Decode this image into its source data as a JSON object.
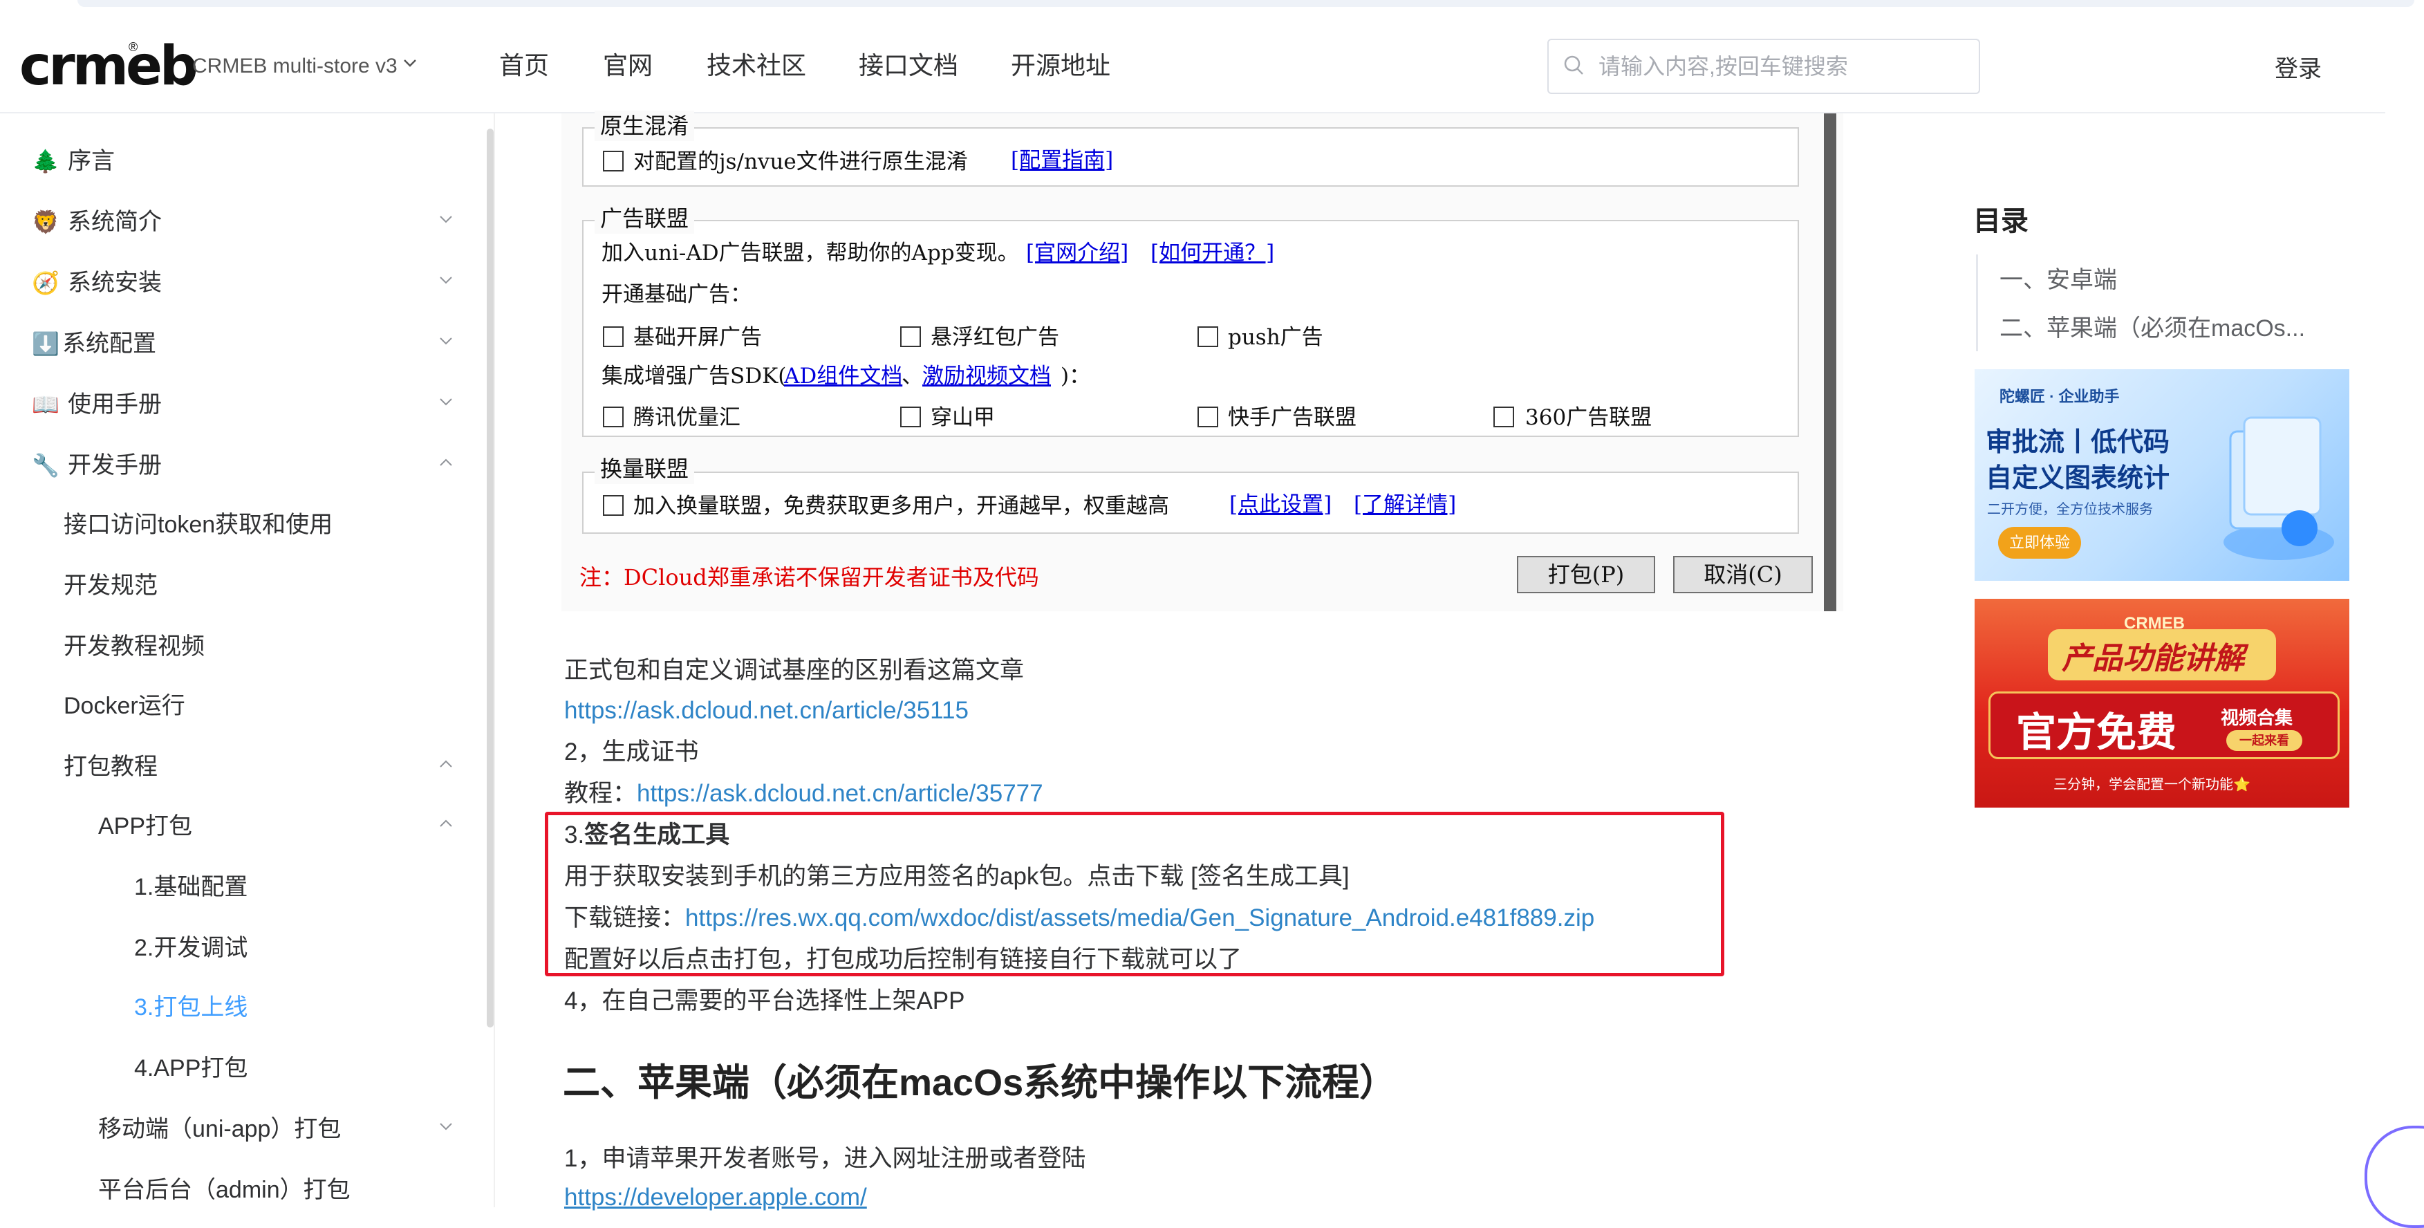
{
  "header": {
    "logo_text": "crmeb",
    "logo_reg": "®",
    "version": "CRMEB multi-store v3",
    "nav": [
      "首页",
      "官网",
      "技术社区",
      "接口文档",
      "开源地址"
    ],
    "search_placeholder": "请输入内容,按回车键搜索",
    "login": "登录"
  },
  "sidebar": {
    "items": [
      {
        "emoji": "🌲",
        "label": "序言"
      },
      {
        "emoji": "🦁",
        "label": "系统简介"
      },
      {
        "emoji": "🧭",
        "label": "系统安装"
      },
      {
        "emoji": "⬇️",
        "label": "系统配置"
      },
      {
        "emoji": "📖",
        "label": "使用手册"
      },
      {
        "emoji": "🔧",
        "label": "开发手册"
      },
      {
        "label": "接口访问token获取和使用"
      },
      {
        "label": "开发规范"
      },
      {
        "label": "开发教程视频"
      },
      {
        "label": "Docker运行"
      },
      {
        "label": "打包教程"
      },
      {
        "label": "APP打包"
      },
      {
        "label": "1.基础配置"
      },
      {
        "label": "2.开发调试"
      },
      {
        "label": "3.打包上线"
      },
      {
        "label": "4.APP打包"
      },
      {
        "label": "移动端（uni-app）打包"
      },
      {
        "label": "平台后台（admin）打包"
      }
    ]
  },
  "dialog": {
    "native": {
      "title": "原生混淆",
      "option": "对配置的js/nvue文件进行原生混淆",
      "link": "[配置指南]"
    },
    "ad": {
      "title": "广告联盟",
      "intro": "加入uni-AD广告联盟，帮助你的App变现。",
      "link1": "[官网介绍]",
      "link2": "[如何开通？]",
      "basic_title": "开通基础广告：",
      "basic": [
        "基础开屏广告",
        "悬浮红包广告",
        "push广告"
      ],
      "sdk_prefix": "集成增强广告SDK(",
      "sdk_link1": "AD组件文档",
      "sdk_sep": "、",
      "sdk_link2": "激励视频文档",
      "sdk_suffix": ")：",
      "sdk": [
        "腾讯优量汇",
        "穿山甲",
        "快手广告联盟",
        "360广告联盟"
      ]
    },
    "exchange": {
      "title": "换量联盟",
      "option": "加入换量联盟，免费获取更多用户，开通越早，权重越高",
      "link1": "[点此设置]",
      "link2": "[了解详情]"
    },
    "note": "注：DCloud郑重承诺不保留开发者证书及代码",
    "btn_pack": "打包(P)",
    "btn_cancel": "取消(C)"
  },
  "article": {
    "p1": "正式包和自定义调试基座的区别看这篇文章",
    "link1": "https://ask.dcloud.net.cn/article/35115",
    "p2": "2，生成证书",
    "p3_prefix": "教程：",
    "link2": "https://ask.dcloud.net.cn/article/35777",
    "p4_num": "3.",
    "p4_bold": "签名生成工具",
    "p5": "用于获取安装到手机的第三方应用签名的apk包。点击下载 [签名生成工具]",
    "p6_prefix": "下载链接：",
    "link3": "https://res.wx.qq.com/wxdoc/dist/assets/media/Gen_Signature_Android.e481f889.zip",
    "p7": "配置好以后点击打包，打包成功后控制有链接自行下载就可以了",
    "p8": "4，在自己需要的平台选择性上架APP",
    "h2": "二、苹果端（必须在macOs系统中操作以下流程）",
    "p9": "1，申请苹果开发者账号，进入网址注册或者登陆",
    "link4": "https://developer.apple.com/"
  },
  "toc": {
    "title": "目录",
    "items": [
      "一、安卓端",
      "二、苹果端（必须在macOs..."
    ]
  },
  "ads": {
    "ad1": {
      "brand": "陀螺匠 · 企业助手",
      "line1": "审批流丨低代码",
      "line2": "自定义图表统计",
      "line3": "二开方便，全方位技术服务",
      "cta": "立即体验"
    },
    "ad2": {
      "brand": "CRMEB",
      "line1": "产品功能讲解",
      "line2": "官方免费",
      "tag": "视频合集",
      "tag2": "一起来看",
      "footer": "三分钟，学会配置一个新功能⭐"
    }
  },
  "colors": {
    "accent": "#409eff",
    "link": "#2e84c7",
    "highlight_box": "#e8142a",
    "dialog_link": "#0000dd",
    "dialog_note": "#e00000"
  }
}
